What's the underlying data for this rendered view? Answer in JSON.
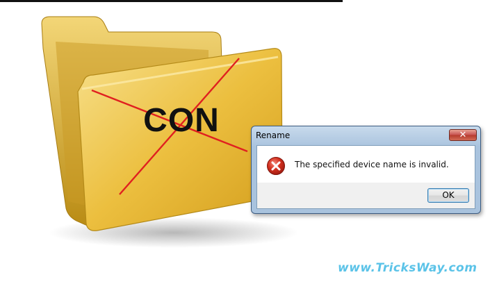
{
  "folder": {
    "label": "CON",
    "icon": "folder-icon",
    "mark": "red-cross-icon"
  },
  "dialog": {
    "title": "Rename",
    "close_label": "✕",
    "message": "The specified device name is invalid.",
    "ok_label": "OK",
    "icon": "error-icon"
  },
  "watermark": "www.TricksWay.com",
  "colors": {
    "folder": "#e8b93a",
    "cross": "#e02020",
    "error": "#d0281c",
    "watermark": "#5bc3e8"
  }
}
